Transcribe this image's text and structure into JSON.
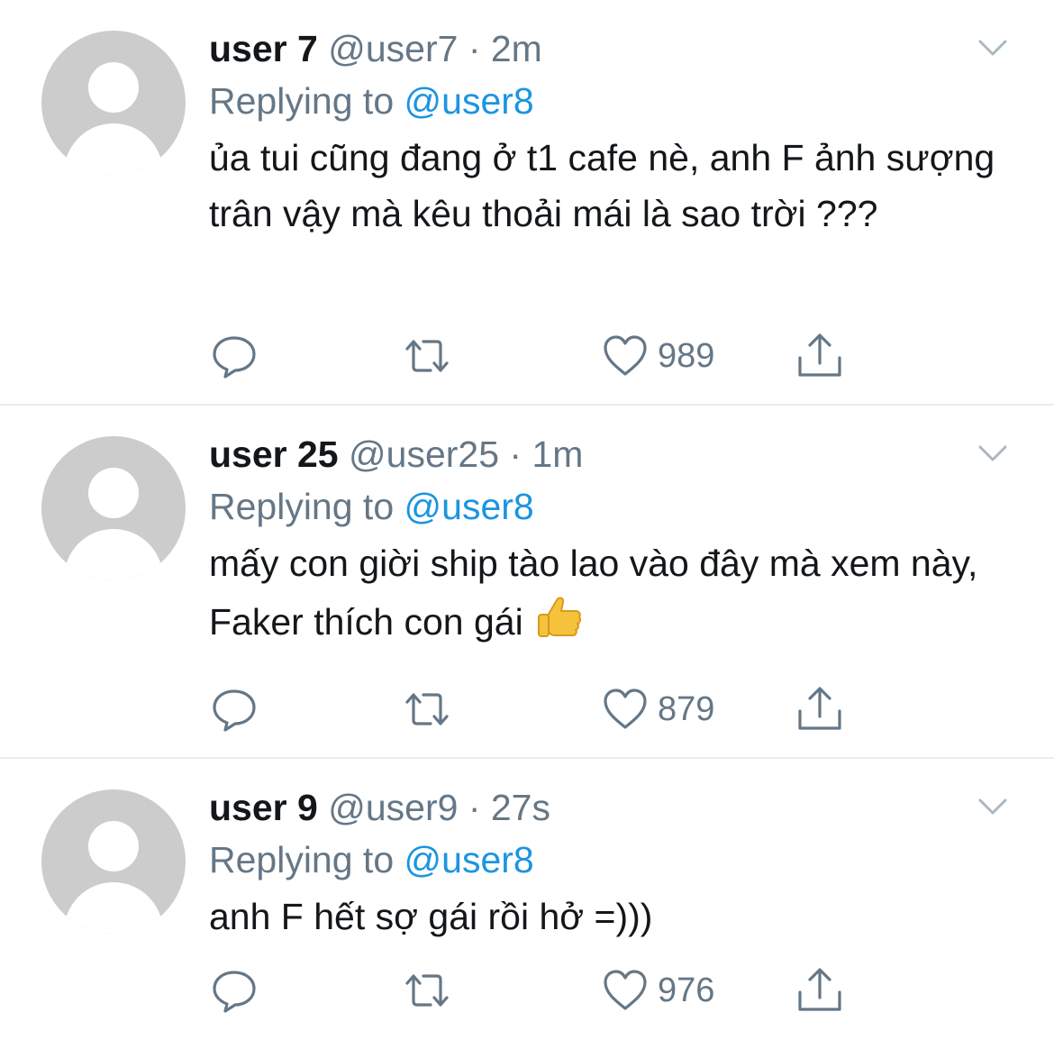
{
  "tweets": [
    {
      "display_name": "user 7",
      "handle": "@user7",
      "separator": "·",
      "time": "2m",
      "replying_prefix": "Replying to",
      "replying_to": "@user8",
      "text": "ủa tui cũng đang ở t1 cafe nè, anh F ảnh sượng trân vậy mà kêu thoải mái là sao trời ???",
      "like_count": "989",
      "icons": {
        "avatar": "default-avatar",
        "reply": "reply-icon",
        "retweet": "retweet-icon",
        "like": "heart-icon",
        "share": "share-icon",
        "menu": "chevron-down-icon"
      }
    },
    {
      "display_name": "user 25",
      "handle": "@user25",
      "separator": "·",
      "time": "1m",
      "replying_prefix": "Replying to",
      "replying_to": "@user8",
      "text": "mấy con giời ship tào lao vào đây mà xem này, Faker thích con gái",
      "emoji": "👍",
      "like_count": "879",
      "icons": {
        "avatar": "default-avatar",
        "reply": "reply-icon",
        "retweet": "retweet-icon",
        "like": "heart-icon",
        "share": "share-icon",
        "menu": "chevron-down-icon",
        "emoji": "thumbs-up-icon"
      }
    },
    {
      "display_name": "user 9",
      "handle": "@user9",
      "separator": "·",
      "time": "27s",
      "replying_prefix": "Replying to",
      "replying_to": "@user8",
      "text": "anh F hết sợ gái rồi hở =)))",
      "like_count": "976",
      "icons": {
        "avatar": "default-avatar",
        "reply": "reply-icon",
        "retweet": "retweet-icon",
        "like": "heart-icon",
        "share": "share-icon",
        "menu": "chevron-down-icon"
      }
    }
  ],
  "colors": {
    "text": "#14171a",
    "secondary": "#657786",
    "link": "#1b95e0",
    "divider": "#e6ecf0",
    "avatar_bg": "#cccccc"
  }
}
